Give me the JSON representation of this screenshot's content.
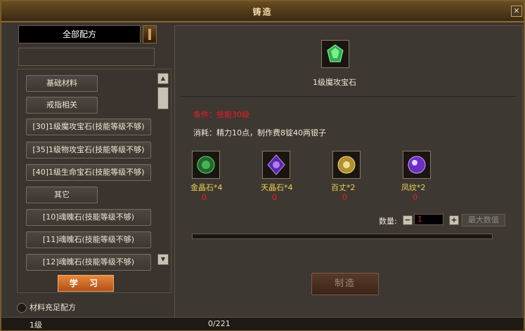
{
  "window": {
    "title": "铸造",
    "close_label": "✕"
  },
  "sidebar": {
    "dropdown_value": "全部配方",
    "list": [
      {
        "label": "基础材料",
        "type": "category"
      },
      {
        "label": "戒指相关",
        "type": "category"
      },
      {
        "label": "[30]1级魔攻宝石(技能等级不够)",
        "type": "recipe"
      },
      {
        "label": "[35]1级物攻宝石(技能等级不够)",
        "type": "recipe"
      },
      {
        "label": "[40]1级生命宝石(技能等级不够)",
        "type": "recipe"
      },
      {
        "label": "其它",
        "type": "category"
      },
      {
        "label": "[10]魂魄石(技能等级不够)",
        "type": "recipe"
      },
      {
        "label": "[11]魂魄石(技能等级不够)",
        "type": "recipe"
      },
      {
        "label": "[12]魂魄石(技能等级不够)",
        "type": "recipe"
      }
    ],
    "learn_label": "学 习",
    "filter_label": "材料充足配方"
  },
  "detail": {
    "item_name": "1级魔攻宝石",
    "condition": "条件：技能30级",
    "cost": "消耗：精力10点，制作费8锭40两银子",
    "materials": [
      {
        "name": "金晶石*4",
        "have": "0",
        "icon": "green-gem-icon",
        "color": "#2a8a3a"
      },
      {
        "name": "天晶石*4",
        "have": "0",
        "icon": "purple-crystal-icon",
        "color": "#7a3ad0"
      },
      {
        "name": "百丈*2",
        "have": "0",
        "icon": "yellow-orb-icon",
        "color": "#d0b040"
      },
      {
        "name": "凤纹*2",
        "have": "0",
        "icon": "violet-sphere-icon",
        "color": "#9a5ae0"
      }
    ],
    "qty_label": "数量:",
    "qty_value": "1",
    "max_label": "最大数值",
    "progress": 0,
    "make_label": "制造"
  },
  "statusbar": {
    "level": "1级",
    "exp": "0/221"
  }
}
